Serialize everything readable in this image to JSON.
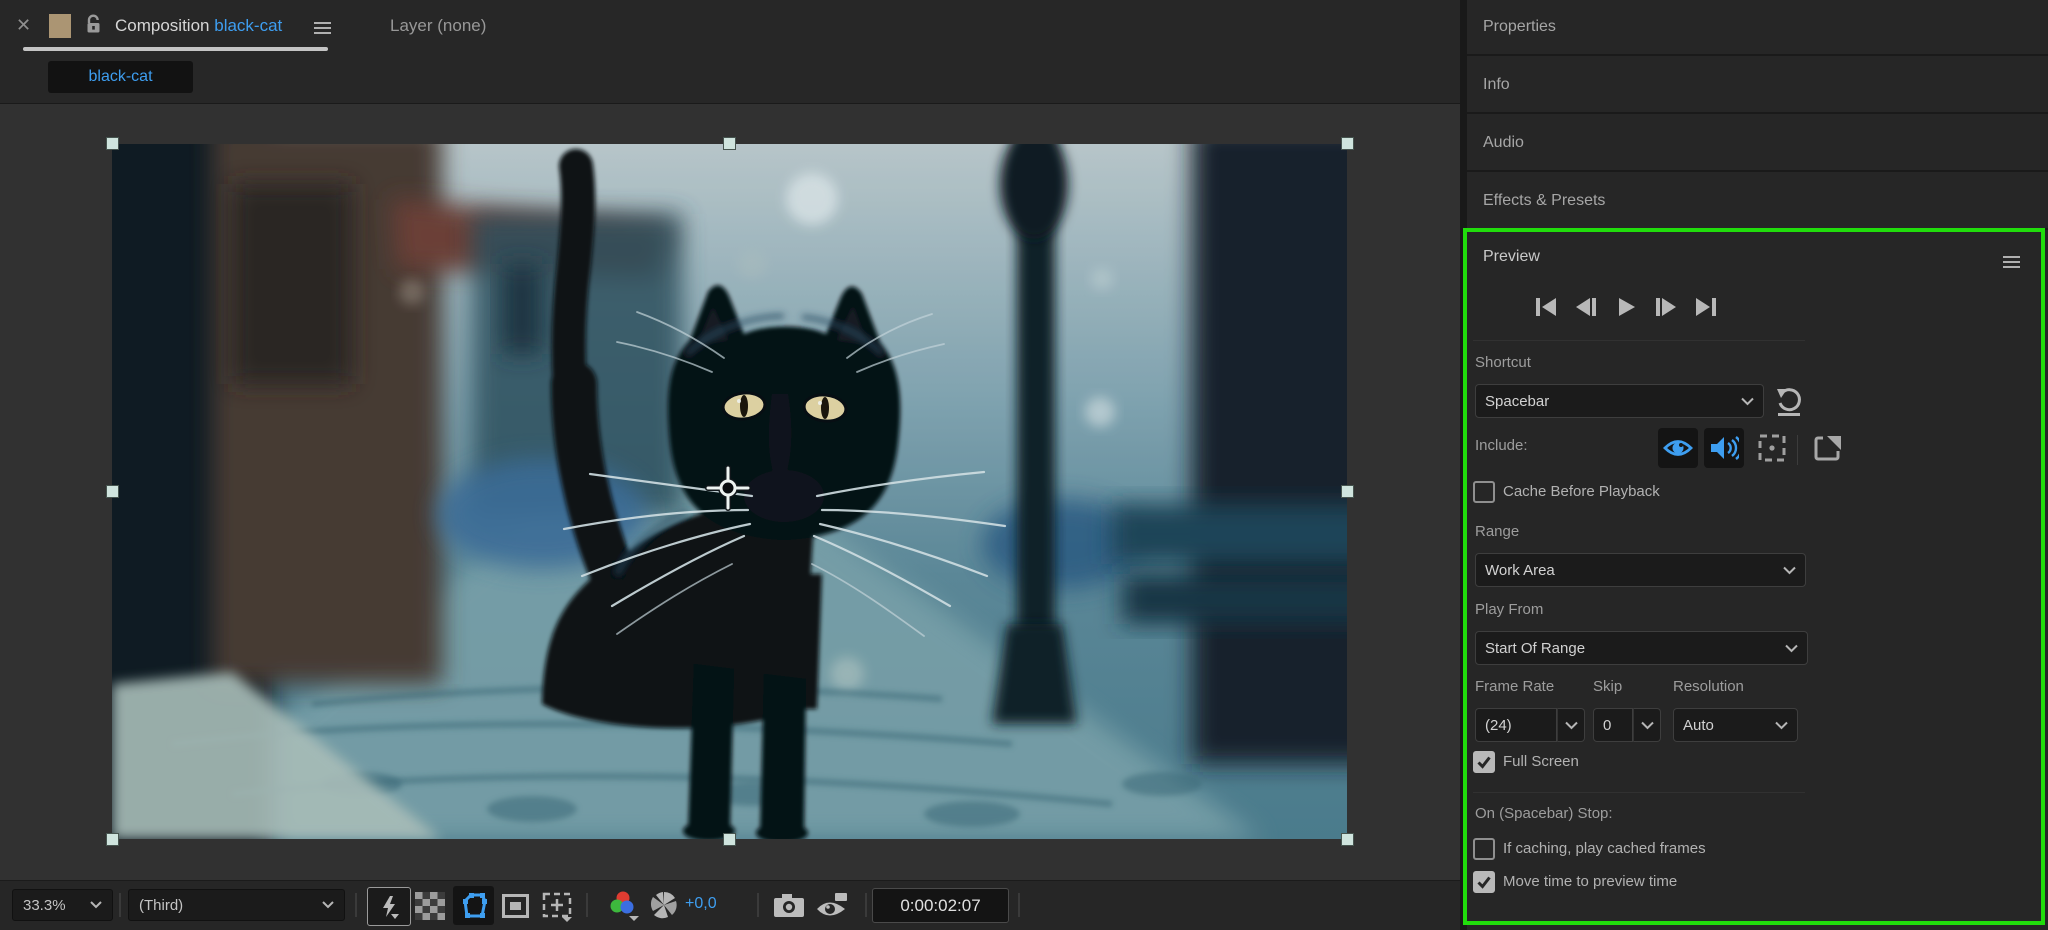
{
  "tabs": {
    "composition_label": "Composition",
    "composition_name": "black-cat",
    "layer_tab_label": "Layer (none)",
    "view_tab_label": "black-cat"
  },
  "toolbar": {
    "zoom_level": "33.3%",
    "resolution": "(Third)",
    "exposure_offset": "+0,0",
    "preview_time": "0:00:02:07"
  },
  "right_panel": {
    "headers": [
      "Properties",
      "Info",
      "Audio",
      "Effects & Presets"
    ]
  },
  "preview": {
    "title": "Preview",
    "shortcut_label": "Shortcut",
    "shortcut_value": "Spacebar",
    "include_label": "Include:",
    "cache_label": "Cache Before Playback",
    "cache_checked": false,
    "range_label": "Range",
    "range_value": "Work Area",
    "play_from_label": "Play From",
    "play_from_value": "Start Of Range",
    "frame_rate_label": "Frame Rate",
    "frame_rate_value": "(24)",
    "skip_label": "Skip",
    "skip_value": "0",
    "resolution_label": "Resolution",
    "resolution_value": "Auto",
    "full_screen_label": "Full Screen",
    "full_screen_checked": true,
    "on_stop_label": "On (Spacebar) Stop:",
    "if_caching_label": "If caching, play cached frames",
    "if_caching_checked": false,
    "move_time_label": "Move time to preview time",
    "move_time_checked": true
  },
  "colors": {
    "accent_blue": "#3e9ef0",
    "highlight_green": "#21dd0c",
    "swatch_tan": "#ab9573",
    "cat_eye_yellow": "#ead9a4"
  }
}
